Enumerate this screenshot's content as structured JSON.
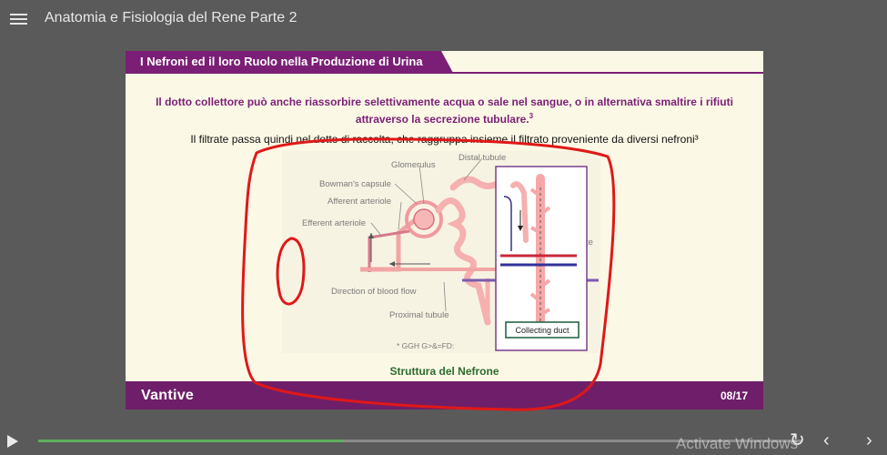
{
  "app": {
    "title": "Anatomia e Fisiologia del Rene Parte 2"
  },
  "slide": {
    "header": "I Nefroni ed il loro Ruolo nella Produzione di Urina",
    "intro_text": "Il dotto collettore può anche riassorbire selettivamente acqua o sale nel sangue, o in alternativa smaltire i rifiuti attraverso la secrezione tubulare.",
    "intro_ref": "3",
    "line2": "Il filtrate passa quindi nel dotto di raccolta, che raggruppa insieme il filtrato proveniente da diversi nefroni³",
    "diagram": {
      "labels": {
        "glomerulus": "Glomerulus",
        "distal_tubule": "Distal tubule",
        "bowmans_capsule": "Bowman's capsule",
        "afferent_arteriole": "Afferent arteriole",
        "efferent_arteriole": "Efferent arteriole",
        "direction_blood_flow": "Direction of blood flow",
        "proximal_tubule": "Proximal tubule",
        "collecting_duct": "Collecting duct",
        "partial_label": "te",
        "garbled_text": "* GGH G>&=FD:"
      }
    },
    "caption": "Struttura del Nefrone",
    "footer": {
      "logo": "Vantive",
      "page": "08/17"
    }
  },
  "player": {
    "progress": 0.4,
    "watermark": "Activate Windows",
    "icons": {
      "menu": "menu-icon",
      "play": "play-icon",
      "replay": "replay-icon",
      "prev": "chevron-left-icon",
      "next": "chevron-right-icon"
    }
  },
  "colors": {
    "brand_purple": "#7a1f75",
    "caption_green": "#2e6b2e",
    "annotation_red": "#e01818",
    "slide_bg": "#fcf8e6"
  }
}
